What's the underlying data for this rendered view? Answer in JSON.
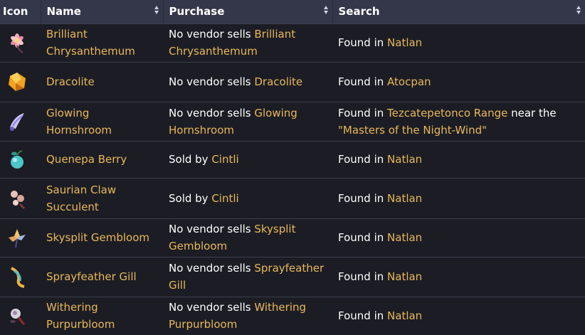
{
  "headers": {
    "icon": "Icon",
    "name": "Name",
    "purchase": "Purchase",
    "search": "Search"
  },
  "rows": [
    {
      "name": "Brilliant Chrysanthemum",
      "icon": "brilliant-chrysanthemum-icon",
      "purchase": {
        "prefix": "No vendor sells ",
        "link": "Brilliant Chrysanthemum"
      },
      "search": {
        "prefix": "Found in ",
        "link": "Natlan",
        "mid": "",
        "link2": ""
      }
    },
    {
      "name": "Dracolite",
      "icon": "dracolite-icon",
      "purchase": {
        "prefix": "No vendor sells ",
        "link": "Dracolite"
      },
      "search": {
        "prefix": "Found in ",
        "link": "Atocpan",
        "mid": "",
        "link2": ""
      }
    },
    {
      "name": "Glowing Hornshroom",
      "icon": "glowing-hornshroom-icon",
      "purchase": {
        "prefix": "No vendor sells ",
        "link": "Glowing Hornshroom"
      },
      "search": {
        "prefix": "Found in ",
        "link": "Tezcatepetonco Range",
        "mid": " near the ",
        "link2": "\"Masters of the Night-Wind\""
      }
    },
    {
      "name": "Quenepa Berry",
      "icon": "quenepa-berry-icon",
      "purchase": {
        "prefix": "Sold by ",
        "link": "Cintli"
      },
      "search": {
        "prefix": "Found in ",
        "link": "Natlan",
        "mid": "",
        "link2": ""
      }
    },
    {
      "name": "Saurian Claw Succulent",
      "icon": "saurian-claw-succulent-icon",
      "purchase": {
        "prefix": "Sold by ",
        "link": "Cintli"
      },
      "search": {
        "prefix": "Found in ",
        "link": "Natlan",
        "mid": "",
        "link2": ""
      }
    },
    {
      "name": "Skysplit Gembloom",
      "icon": "skysplit-gembloom-icon",
      "purchase": {
        "prefix": "No vendor sells ",
        "link": "Skysplit Gembloom"
      },
      "search": {
        "prefix": "Found in ",
        "link": "Natlan",
        "mid": "",
        "link2": ""
      }
    },
    {
      "name": "Sprayfeather Gill",
      "icon": "sprayfeather-gill-icon",
      "purchase": {
        "prefix": "No vendor sells ",
        "link": "Sprayfeather Gill"
      },
      "search": {
        "prefix": "Found in ",
        "link": "Natlan",
        "mid": "",
        "link2": ""
      }
    },
    {
      "name": "Withering Purpurbloom",
      "icon": "withering-purpurbloom-icon",
      "purchase": {
        "prefix": "No vendor sells ",
        "link": "Withering Purpurbloom"
      },
      "search": {
        "prefix": "Found in ",
        "link": "Natlan",
        "mid": "",
        "link2": ""
      }
    }
  ],
  "colors": {
    "header_bg": "#34374a",
    "row_bg": "#1c1d24",
    "link": "#e8b85a",
    "border": "#3a3d4c"
  }
}
